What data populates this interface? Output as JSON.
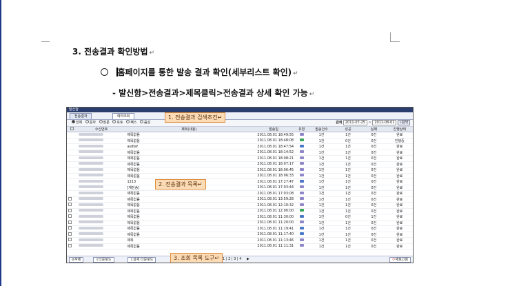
{
  "doc": {
    "heading": "3. 전송결과 확인방법",
    "bullet_prefix": "홈",
    "bullet_text": "페이지를 통한 발송 결과 확인(세부리스트 확인)",
    "sub_text": "- 발신함>전송결과>제목클릭>전송결과 상세 확인 가능",
    "return_mark": "↵"
  },
  "window": {
    "title": "발신함",
    "tabs": [
      "전송결과",
      "예약조회"
    ],
    "filters": [
      "전체",
      "문자",
      "장문",
      "포토",
      "팩스",
      "음성"
    ],
    "search_label": "검색",
    "date_from": "2011-07-25",
    "date_sep": "~",
    "date_to": "2011-08-01",
    "search_button": "검색",
    "columns": [
      "수신번호",
      "제목(내용)",
      "발송일",
      "유형",
      "발송건수",
      "성공",
      "실패",
      "진행상태"
    ],
    "rows": [
      {
        "title": "제목없음",
        "date": "2011.08.01 18:49:55",
        "count": "1건",
        "ok": "1건",
        "fail": "0건",
        "status": "완료",
        "type": "purple",
        "chk": false
      },
      {
        "title": "제목없음",
        "date": "2011.08.01 18:48:08",
        "count": "1건",
        "ok": "0건",
        "fail": "0건",
        "status": "진행중",
        "type": "green",
        "chk": false
      },
      {
        "title": "asdfaf",
        "date": "2011.08.01 18:47:54",
        "count": "1건",
        "ok": "1건",
        "fail": "0건",
        "status": "완료",
        "type": "blue",
        "chk": false
      },
      {
        "title": "제목없음",
        "date": "2011.08.01 18:14:52",
        "count": "1건",
        "ok": "1건",
        "fail": "0건",
        "status": "완료",
        "type": "purple",
        "chk": false
      },
      {
        "title": "제목없음",
        "date": "2011.08.01 18:08:21",
        "count": "1건",
        "ok": "1건",
        "fail": "0건",
        "status": "완료",
        "type": "purple",
        "chk": false
      },
      {
        "title": "제목없음",
        "date": "2011.08.01 18:07:17",
        "count": "1건",
        "ok": "1건",
        "fail": "0건",
        "status": "완료",
        "type": "purple",
        "chk": false
      },
      {
        "title": "제목없음",
        "date": "2011.08.01 18:06:45",
        "count": "1건",
        "ok": "1건",
        "fail": "0건",
        "status": "완료",
        "type": "purple",
        "chk": false
      },
      {
        "title": "제목없음",
        "date": "2011.08.01 18:06:33",
        "count": "1건",
        "ok": "1건",
        "fail": "0건",
        "status": "완료",
        "type": "purple",
        "chk": false
      },
      {
        "title": "1213",
        "date": "2011.08.01 17:27:47",
        "count": "1건",
        "ok": "1건",
        "fail": "0건",
        "status": "완료",
        "type": "blue",
        "chk": false
      },
      {
        "title": "[재전송]",
        "date": "2011.08.01 17:03:44",
        "count": "1건",
        "ok": "1건",
        "fail": "0건",
        "status": "완료",
        "type": "purple",
        "chk": false
      },
      {
        "title": "제목없음",
        "date": "2011.08.01 17:03:08",
        "count": "1건",
        "ok": "1건",
        "fail": "0건",
        "status": "완료",
        "type": "purple",
        "chk": false
      },
      {
        "title": "제목없음",
        "date": "2011.08.01 13:59:28",
        "count": "1건",
        "ok": "1건",
        "fail": "0건",
        "status": "완료",
        "type": "purple",
        "chk": true
      },
      {
        "title": "제목없음",
        "date": "2011.08.01 12:10:32",
        "count": "1건",
        "ok": "1건",
        "fail": "0건",
        "status": "완료",
        "type": "purple",
        "chk": true
      },
      {
        "title": "제목없음",
        "date": "2011.08.01 12:00:00",
        "count": "1건",
        "ok": "1건",
        "fail": "0건",
        "status": "완료",
        "type": "green",
        "chk": true
      },
      {
        "title": "제목없음",
        "date": "2011.08.01 11:30:00",
        "count": "1건",
        "ok": "0건",
        "fail": "1건",
        "status": "완료",
        "type": "blue",
        "chk": true
      },
      {
        "title": "제목없음",
        "date": "2011.08.01 11:20:00",
        "count": "1건",
        "ok": "1건",
        "fail": "0건",
        "status": "완료",
        "type": "purple",
        "chk": true
      },
      {
        "title": "제목없음",
        "date": "2011.08.01 11:19:41",
        "count": "1건",
        "ok": "1건",
        "fail": "0건",
        "status": "완료",
        "type": "blue",
        "chk": true
      },
      {
        "title": "제목없음",
        "date": "2011.08.01 11:17:40",
        "count": "1건",
        "ok": "1건",
        "fail": "0건",
        "status": "완료",
        "type": "blue",
        "chk": true
      },
      {
        "title": "제목",
        "date": "2011.08.01 11:13:46",
        "count": "1건",
        "ok": "1건",
        "fail": "0건",
        "status": "완료",
        "type": "purple",
        "chk": true
      },
      {
        "title": "제목없음",
        "date": "2011.08.01 11:11:31",
        "count": "1건",
        "ok": "1건",
        "fail": "0건",
        "status": "완료",
        "type": "purple",
        "chk": true
      }
    ],
    "toolbar": {
      "delete": "삭제",
      "download": "다운로드",
      "detail_download": "상세 다운로드",
      "pages": [
        "1",
        "2",
        "3",
        "4"
      ],
      "next": "▶",
      "refresh": "새로고침"
    }
  },
  "callouts": {
    "c1": "1. 전송결과 검색조건↵",
    "c2": "2. 전송결과 목록↵",
    "c3": "3. 조회 목록 도구↵"
  },
  "colors": {
    "purple": "#8f86c9",
    "green": "#3aa65a",
    "blue": "#4a78c8",
    "callout_bg": "#fbdcb6",
    "callout_border": "#e08d3a"
  }
}
